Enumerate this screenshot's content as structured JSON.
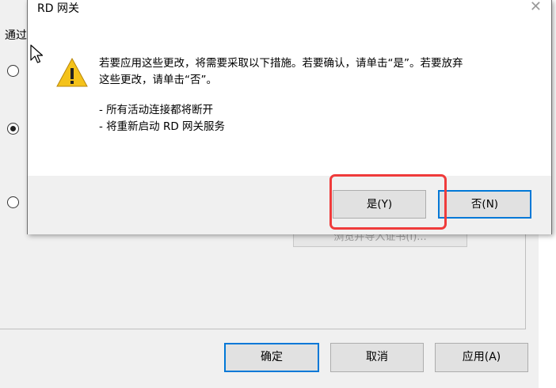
{
  "background_window": {
    "partial_label": "通过",
    "radio_options": [
      {
        "checked": false
      },
      {
        "checked": true
      },
      {
        "checked": false
      }
    ],
    "obscured_button_label": "浏览并导入证书(I)...",
    "buttons": {
      "ok": "确定",
      "cancel": "取消",
      "apply": "应用(A)"
    }
  },
  "dialog": {
    "title": "RD 网关",
    "close_glyph": "✕",
    "icon": "warning-triangle-icon",
    "message_line1": "若要应用这些更改，将需要采取以下措施。若要确认，请单击“是”。若要放弃",
    "message_line2": "这些更改，请单击“否”。",
    "bullet1": "- 所有活动连接都将断开",
    "bullet2": "- 将重新启动 RD 网关服务",
    "yes_button": "是(Y)",
    "no_button": "否(N)"
  },
  "annotation": {
    "highlight_color": "#ef3b3b",
    "highlight_target": "yes-button"
  },
  "colors": {
    "accent": "#0078d7",
    "warning": "#f4c21a"
  }
}
